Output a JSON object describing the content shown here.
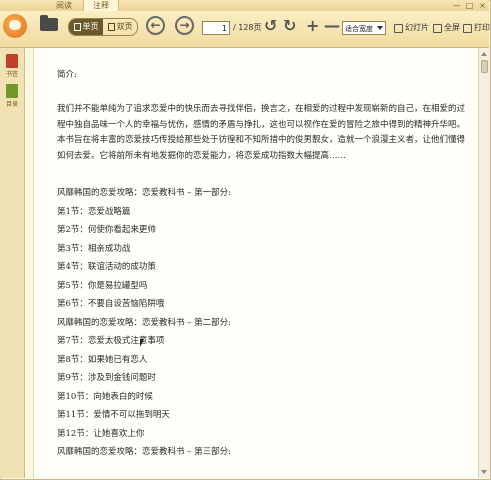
{
  "tabs": {
    "read": "阅读",
    "note": "注释"
  },
  "window_controls": {
    "minimize": "—",
    "maximize": "□",
    "close": "×"
  },
  "toolbar": {
    "single_page": "单页",
    "double_page": "双页",
    "back": "←",
    "forward": "→",
    "page_current": "1",
    "page_total": "/ 128页",
    "rotate_left": "↺",
    "rotate_right": "↻",
    "zoom_in": "+",
    "zoom_out": "—",
    "zoom_value": "适合宽度",
    "slideshow": "幻灯片",
    "fullscreen": "全屏",
    "print": "打印"
  },
  "sidebar": {
    "bookmark": "书签",
    "toc": "目录"
  },
  "content": {
    "intro_title": "简介:",
    "intro_body": "我们并不能单纯为了追求恋爱中的快乐而去寻找伴侣，换言之，在相爱的过程中发现崭新的自己，在相爱的过程中独自品味一个人的幸福与忧伤，感情的矛盾与挣扎，这也可以视作在爱的冒险之旅中得到的精神升华吧。本书旨在将丰富的恋爱技巧传授给那些处于彷徨和不知所措中的俊男靓女，造就一个浪漫主义者，让他们懂得如何去爱。它将前所未有地发掘你的恋爱能力，将恋爱成功指数大幅提高……",
    "lines": [
      "风靡韩国的恋爱攻略：恋爱教科书 – 第一部分:",
      "第1节：恋爱战略篇",
      "第2节：何使你看起来更帅",
      "第3节：相亲成功战",
      "第4节：联谊活动的成功策",
      "第5节：你是易拉罐型吗",
      "第6节：不要自设苦恼陷阱哦",
      "风靡韩国的恋爱攻略：恋爱教科书 – 第二部分:",
      "第7节：恋爱太极式注意事项",
      "第8节：如果她已有恋人",
      "第9节：涉及到金钱问题时",
      "第10节：向她表白的时候",
      "第11节：爱情不可以拖到明天",
      "第12节：让她喜欢上你",
      "风靡韩国的恋爱攻略：恋爱教科书 – 第三部分:"
    ]
  },
  "colors": {
    "toolbar_bg": "#f1dca0",
    "page_bg": "#fffef8",
    "accent_logo": "#e0701a"
  }
}
